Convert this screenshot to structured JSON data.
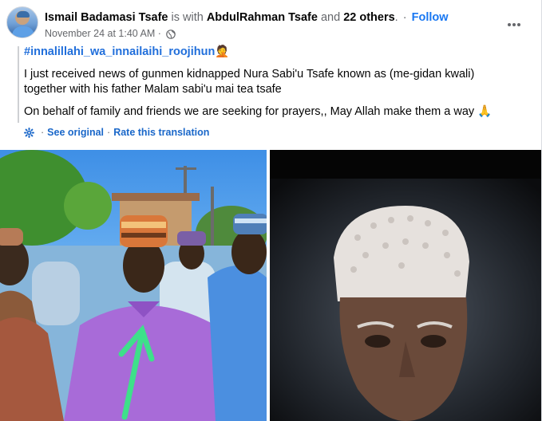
{
  "post": {
    "author": "Ismail Badamasi Tsafe",
    "with_word": " is with ",
    "tagged": "AbdulRahman Tsafe",
    "and_word": " and ",
    "others": "22 others",
    "dot": ".",
    "separator": "·",
    "follow": "Follow",
    "timestamp": "November 24 at 1:40 AM",
    "timestamp_sep": "·",
    "privacy_icon": "globe-icon",
    "more_icon": "more-horizontal-icon"
  },
  "body": {
    "hashtag": "#innalillahi_wa_innailaihi_roojihun",
    "hashtag_emoji": "🤦",
    "line1": "I just received news of gunmen kidnapped Nura Sabi'u Tsafe known as (me-gidan kwali) together with his father Malam sabi'u mai tea tsafe",
    "line2": "On behalf of family and friends we are seeking for prayers,, May Allah make them a way",
    "line2_emoji": "🙏"
  },
  "translation": {
    "icon": "gear-icon",
    "see_original": "See original",
    "sep": "·",
    "rate": "Rate this translation"
  },
  "photos": {
    "left": "crowd-photo",
    "right": "elder-portrait-photo"
  },
  "colors": {
    "link": "#1877f2",
    "hashtag": "#216fdb",
    "muted": "#65676b",
    "arrow": "#3ee08a"
  }
}
